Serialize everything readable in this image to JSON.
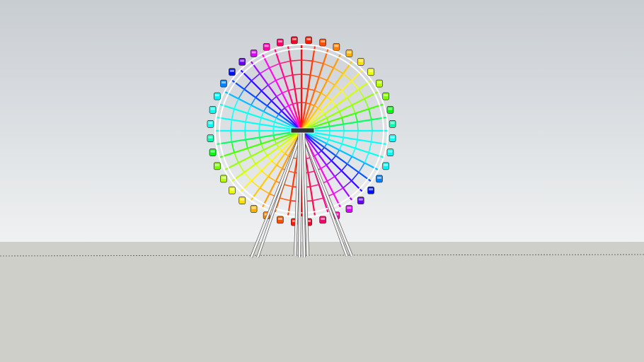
{
  "scene": {
    "sky_top": "#c8cdd2",
    "sky_horizon": "#eff1f2",
    "ground": "#cfcfca",
    "horizon_line": "#555555",
    "rim_color": "#ffffff",
    "leg_color": "#f4f4f4",
    "gondola_count": 40,
    "hub_label_color": "#222222"
  }
}
